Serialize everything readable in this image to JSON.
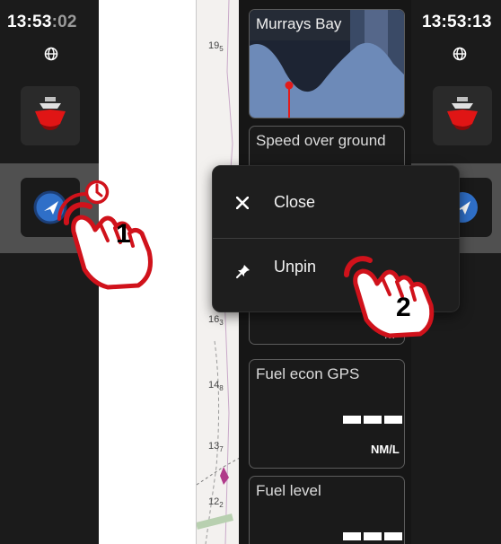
{
  "step1": {
    "clock": {
      "hm": "13:53",
      "sec": ":02"
    },
    "step_number": "1"
  },
  "map": {
    "depths": [
      {
        "main": "19",
        "sub": "5"
      },
      {
        "main": "16",
        "sub": "3"
      },
      {
        "main": "14",
        "sub": "8"
      },
      {
        "main": "13",
        "sub": "7"
      },
      {
        "main": "12",
        "sub": "2"
      }
    ]
  },
  "widgets": {
    "tide": {
      "title": "Murrays Bay"
    },
    "speed": {
      "title": "Speed over ground"
    },
    "fuel_econ": {
      "title": "Fuel econ GPS",
      "unit": "NM/L"
    },
    "fuel_level": {
      "title": "Fuel level"
    }
  },
  "menu": {
    "close_label": "Close",
    "unpin_label": "Unpin"
  },
  "step2": {
    "clock": "13:53:13",
    "step_number": "2"
  },
  "icons": [
    "globe-icon",
    "boat-sonar-icon",
    "navigation-arrow-icon",
    "clock-icon",
    "close-icon",
    "pin-icon",
    "hand-pointer-icon"
  ],
  "colors": {
    "accent_red": "#d0121b",
    "nav_blue": "#2f6fc8",
    "tide_blue": "#6d8ab8"
  }
}
